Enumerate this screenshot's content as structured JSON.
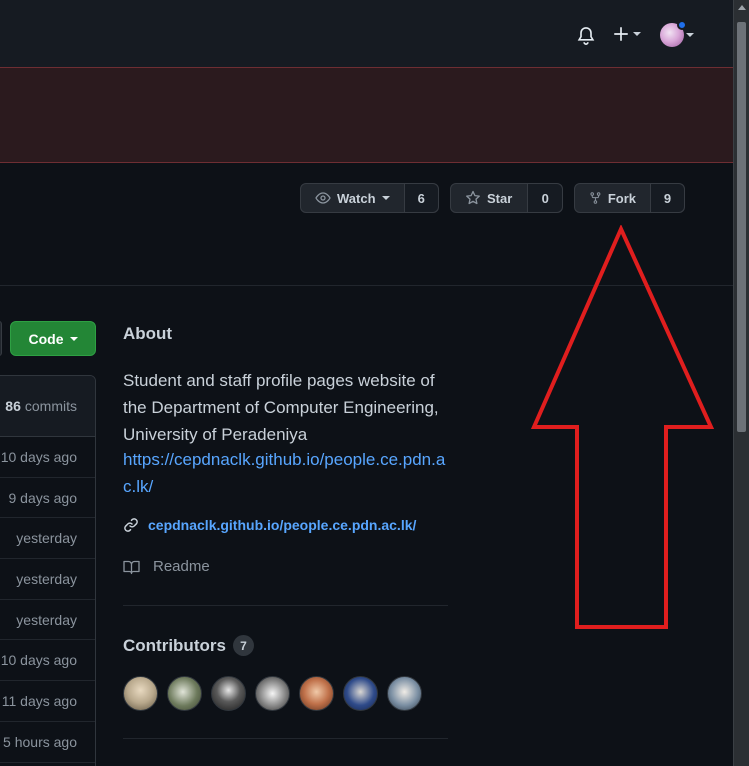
{
  "header": {
    "bell_icon": "bell-icon",
    "plus_icon": "plus-icon",
    "avatar_icon": "user-avatar",
    "notification_color": "#1f6feb"
  },
  "repo_actions": {
    "watch": {
      "label": "Watch",
      "count": "6",
      "icon": "eye-icon"
    },
    "star": {
      "label": "Star",
      "count": "0",
      "icon": "star-icon"
    },
    "fork": {
      "label": "Fork",
      "count": "9",
      "icon": "repo-forked-icon"
    }
  },
  "code_button": {
    "label": "Code",
    "color": "#238636"
  },
  "commits": {
    "count": "86",
    "label": "commits",
    "rows": [
      "10 days ago",
      "9 days ago",
      "yesterday",
      "yesterday",
      "yesterday",
      "10 days ago",
      "11 days ago",
      "5 hours ago"
    ]
  },
  "about": {
    "title": "About",
    "description": "Student and staff profile pages website of the Department of Computer Engineering, University of Peradeniya",
    "url": "https://cepdnaclk.github.io/people.ce.pdn.ac.lk/",
    "website": "cepdnaclk.github.io/people.ce.pdn.ac.lk/",
    "readme": "Readme"
  },
  "contributors": {
    "title": "Contributors",
    "count": "7",
    "avatars": [
      {
        "name": "contributor-1",
        "color": "#b8a88c"
      },
      {
        "name": "contributor-2",
        "color": "#6d7a5c"
      },
      {
        "name": "contributor-3",
        "color": "#2a2a2a"
      },
      {
        "name": "contributor-4",
        "color": "#9a9a9a"
      },
      {
        "name": "contributor-5",
        "color": "#c0714a"
      },
      {
        "name": "contributor-6",
        "color": "#2f4b8a"
      },
      {
        "name": "contributor-7",
        "color": "#7b8fa3"
      }
    ]
  },
  "annotation": {
    "color": "#e01e1e",
    "type": "arrow-up"
  }
}
